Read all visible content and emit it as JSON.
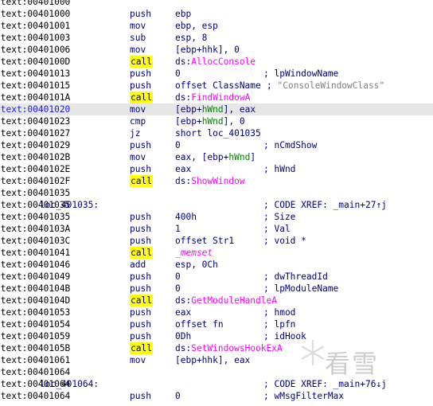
{
  "listing": [
    {
      "addr": ".text:00401000",
      "label": "",
      "mnem": "",
      "ops": [],
      "cmt": []
    },
    {
      "addr": ".text:00401000",
      "label": "",
      "mnem": "push",
      "ops": [
        {
          "t": "ebp",
          "c": ""
        }
      ],
      "cmt": []
    },
    {
      "addr": ".text:00401001",
      "label": "",
      "mnem": "mov",
      "ops": [
        {
          "t": "ebp, esp",
          "c": ""
        }
      ],
      "cmt": []
    },
    {
      "addr": ".text:00401003",
      "label": "",
      "mnem": "sub",
      "ops": [
        {
          "t": "esp, 8",
          "c": ""
        }
      ],
      "cmt": []
    },
    {
      "addr": ".text:00401006",
      "label": "",
      "mnem": "mov",
      "ops": [
        {
          "t": "[ebp+hhk], 0",
          "c": ""
        }
      ],
      "cmt": []
    },
    {
      "addr": ".text:0040100D",
      "label": "",
      "mnem": "call",
      "ops": [
        {
          "t": "ds:",
          "c": ""
        },
        {
          "t": "AllocConsole",
          "c": "imp"
        }
      ],
      "cmt": []
    },
    {
      "addr": ".text:00401013",
      "label": "",
      "mnem": "push",
      "ops": [
        {
          "t": "0",
          "c": ""
        }
      ],
      "cmt": [
        {
          "t": "; lpWindowName",
          "c": ""
        }
      ]
    },
    {
      "addr": ".text:00401015",
      "label": "",
      "mnem": "push",
      "ops": [
        {
          "t": "offset ClassName",
          "c": ""
        }
      ],
      "cmt": [
        {
          "t": "; ",
          "c": ""
        },
        {
          "t": "\"ConsoleWindowClass\"",
          "c": "str"
        }
      ],
      "cmt_inline": true
    },
    {
      "addr": ".text:0040101A",
      "label": "",
      "mnem": "call",
      "ops": [
        {
          "t": "ds:",
          "c": ""
        },
        {
          "t": "FindWindowA",
          "c": "imp"
        }
      ],
      "cmt": []
    },
    {
      "addr": ".text:00401020",
      "label": "",
      "mnem": "mov",
      "ops": [
        {
          "t": "[ebp+",
          "c": ""
        },
        {
          "t": "hWnd",
          "c": "lv"
        },
        {
          "t": "], eax",
          "c": ""
        }
      ],
      "cmt": [],
      "highlight": true
    },
    {
      "addr": ".text:00401023",
      "label": "",
      "mnem": "cmp",
      "ops": [
        {
          "t": "[ebp+",
          "c": ""
        },
        {
          "t": "hWnd",
          "c": "lv"
        },
        {
          "t": "], 0",
          "c": ""
        }
      ],
      "cmt": []
    },
    {
      "addr": ".text:00401027",
      "label": "",
      "mnem": "jz",
      "ops": [
        {
          "t": "short loc_401035",
          "c": ""
        }
      ],
      "cmt": []
    },
    {
      "addr": ".text:00401029",
      "label": "",
      "mnem": "push",
      "ops": [
        {
          "t": "0",
          "c": ""
        }
      ],
      "cmt": [
        {
          "t": "; nCmdShow",
          "c": ""
        }
      ]
    },
    {
      "addr": ".text:0040102B",
      "label": "",
      "mnem": "mov",
      "ops": [
        {
          "t": "eax, [ebp+",
          "c": ""
        },
        {
          "t": "hWnd",
          "c": "lv"
        },
        {
          "t": "]",
          "c": ""
        }
      ],
      "cmt": []
    },
    {
      "addr": ".text:0040102E",
      "label": "",
      "mnem": "push",
      "ops": [
        {
          "t": "eax",
          "c": ""
        }
      ],
      "cmt": [
        {
          "t": "; hWnd",
          "c": ""
        }
      ]
    },
    {
      "addr": ".text:0040102F",
      "label": "",
      "mnem": "call",
      "ops": [
        {
          "t": "ds:",
          "c": ""
        },
        {
          "t": "ShowWindow",
          "c": "imp"
        }
      ],
      "cmt": []
    },
    {
      "addr": ".text:00401035",
      "label": "",
      "mnem": "",
      "ops": [],
      "cmt": []
    },
    {
      "addr": ".text:00401035",
      "label": "loc_401035:",
      "mnem": "",
      "ops": [],
      "cmt": [
        {
          "t": "; CODE XREF: _main+27↑j",
          "c": ""
        }
      ]
    },
    {
      "addr": ".text:00401035",
      "label": "",
      "mnem": "push",
      "ops": [
        {
          "t": "400h",
          "c": ""
        }
      ],
      "cmt": [
        {
          "t": "; Size",
          "c": ""
        }
      ]
    },
    {
      "addr": ".text:0040103A",
      "label": "",
      "mnem": "push",
      "ops": [
        {
          "t": "1",
          "c": ""
        }
      ],
      "cmt": [
        {
          "t": "; Val",
          "c": ""
        }
      ]
    },
    {
      "addr": ".text:0040103C",
      "label": "",
      "mnem": "push",
      "ops": [
        {
          "t": "offset Str1",
          "c": ""
        }
      ],
      "cmt": [
        {
          "t": "; void *",
          "c": ""
        }
      ]
    },
    {
      "addr": ".text:00401041",
      "label": "",
      "mnem": "call",
      "ops": [
        {
          "t": "_memset",
          "c": "fn"
        }
      ],
      "cmt": []
    },
    {
      "addr": ".text:00401046",
      "label": "",
      "mnem": "add",
      "ops": [
        {
          "t": "esp, 0Ch",
          "c": ""
        }
      ],
      "cmt": []
    },
    {
      "addr": ".text:00401049",
      "label": "",
      "mnem": "push",
      "ops": [
        {
          "t": "0",
          "c": ""
        }
      ],
      "cmt": [
        {
          "t": "; dwThreadId",
          "c": ""
        }
      ]
    },
    {
      "addr": ".text:0040104B",
      "label": "",
      "mnem": "push",
      "ops": [
        {
          "t": "0",
          "c": ""
        }
      ],
      "cmt": [
        {
          "t": "; lpModuleName",
          "c": ""
        }
      ]
    },
    {
      "addr": ".text:0040104D",
      "label": "",
      "mnem": "call",
      "ops": [
        {
          "t": "ds:",
          "c": ""
        },
        {
          "t": "GetModuleHandleA",
          "c": "imp"
        }
      ],
      "cmt": []
    },
    {
      "addr": ".text:00401053",
      "label": "",
      "mnem": "push",
      "ops": [
        {
          "t": "eax",
          "c": ""
        }
      ],
      "cmt": [
        {
          "t": "; hmod",
          "c": ""
        }
      ]
    },
    {
      "addr": ".text:00401054",
      "label": "",
      "mnem": "push",
      "ops": [
        {
          "t": "offset fn",
          "c": ""
        }
      ],
      "cmt": [
        {
          "t": "; lpfn",
          "c": ""
        }
      ]
    },
    {
      "addr": ".text:00401059",
      "label": "",
      "mnem": "push",
      "ops": [
        {
          "t": "0Dh",
          "c": ""
        }
      ],
      "cmt": [
        {
          "t": "; idHook",
          "c": ""
        }
      ]
    },
    {
      "addr": ".text:0040105B",
      "label": "",
      "mnem": "call",
      "ops": [
        {
          "t": "ds:",
          "c": ""
        },
        {
          "t": "SetWindowsHookExA",
          "c": "imp"
        }
      ],
      "cmt": []
    },
    {
      "addr": ".text:00401061",
      "label": "",
      "mnem": "mov",
      "ops": [
        {
          "t": "[ebp+hhk], eax",
          "c": ""
        }
      ],
      "cmt": []
    },
    {
      "addr": ".text:00401064",
      "label": "",
      "mnem": "",
      "ops": [],
      "cmt": []
    },
    {
      "addr": ".text:00401064",
      "label": "loc_401064:",
      "mnem": "",
      "ops": [],
      "cmt": [
        {
          "t": "; CODE XREF: _main+76↓j",
          "c": ""
        }
      ]
    },
    {
      "addr": ".text:00401064",
      "label": "",
      "mnem": "push",
      "ops": [
        {
          "t": "0",
          "c": ""
        }
      ],
      "cmt": [
        {
          "t": "; wMsgFilterMax",
          "c": ""
        }
      ]
    }
  ],
  "watermark": {
    "text": "看雪"
  },
  "colors": {
    "text": "#000080",
    "import": "#ff00ff",
    "local_var": "#008000",
    "call_highlight": "#ffff00",
    "line_highlight": "#e6e6e6"
  }
}
